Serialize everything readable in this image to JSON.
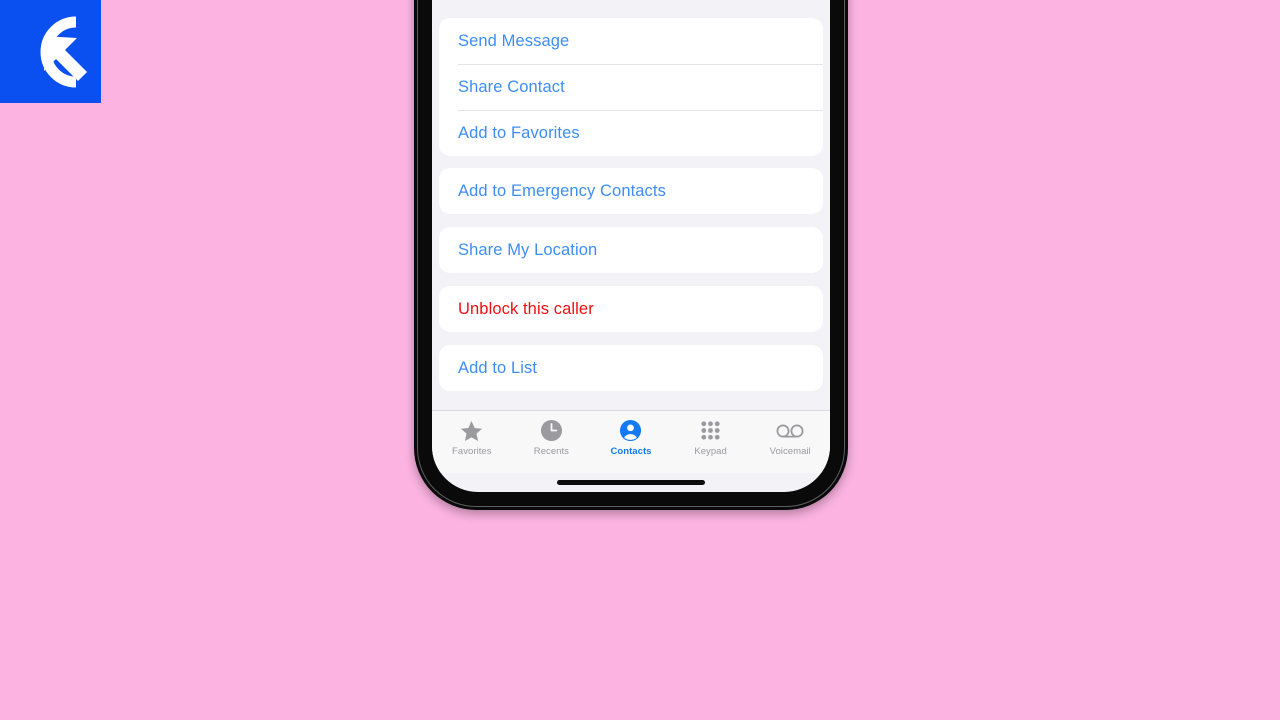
{
  "watermark": {
    "name": "getdroidtips-logo",
    "background_color": "#0a50f0",
    "mark_color": "#ffffff"
  },
  "page_background_color": "#fcb3e2",
  "device": {
    "frame_color": "#0a0a0a",
    "screen_background": "#f2f2f7"
  },
  "screen": {
    "app": "Phone",
    "view": "Contact Details Actions",
    "accent_color": "#3d8df5",
    "destructive_color": "#f20f12",
    "groups": [
      {
        "id": "contact-actions",
        "rows": [
          {
            "label": "Send Message",
            "style": "default"
          },
          {
            "label": "Share Contact",
            "style": "default"
          },
          {
            "label": "Add to Favorites",
            "style": "default"
          }
        ]
      },
      {
        "id": "emergency",
        "rows": [
          {
            "label": "Add to Emergency Contacts",
            "style": "default"
          }
        ]
      },
      {
        "id": "location",
        "rows": [
          {
            "label": "Share My Location",
            "style": "default"
          }
        ]
      },
      {
        "id": "block",
        "rows": [
          {
            "label": "Unblock this caller",
            "style": "destructive"
          }
        ]
      },
      {
        "id": "lists",
        "rows": [
          {
            "label": "Add to List",
            "style": "default"
          }
        ]
      }
    ],
    "tabbar": {
      "background_color": "#f8f8f9",
      "inactive_color": "#9a9a9f",
      "active_color": "#1579f2",
      "tabs": [
        {
          "label": "Favorites",
          "icon": "star-icon",
          "active": false
        },
        {
          "label": "Recents",
          "icon": "clock-icon",
          "active": false
        },
        {
          "label": "Contacts",
          "icon": "person-circle-icon",
          "active": true
        },
        {
          "label": "Keypad",
          "icon": "keypad-grid-icon",
          "active": false
        },
        {
          "label": "Voicemail",
          "icon": "voicemail-icon",
          "active": false
        }
      ]
    }
  }
}
